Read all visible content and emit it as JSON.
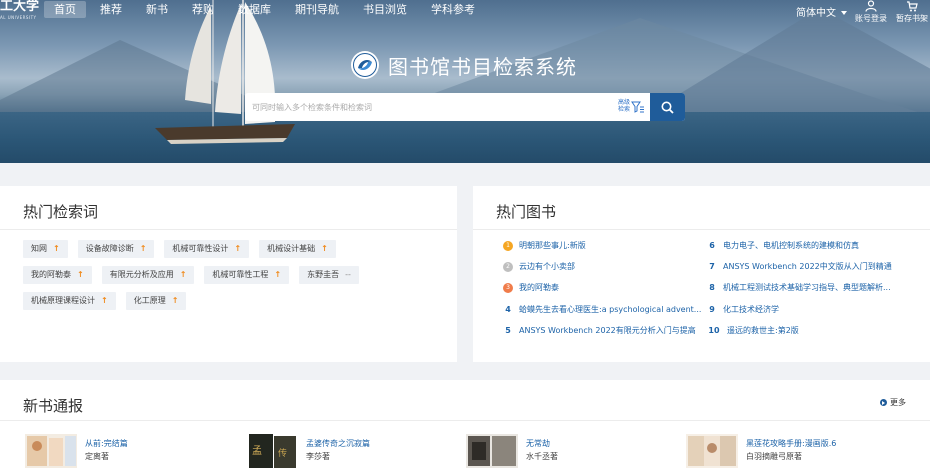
{
  "header": {
    "logo_text": "工大学",
    "logo_sub": "AL UNIVERSITY",
    "nav": [
      {
        "label": "首页",
        "active": true
      },
      {
        "label": "推荐"
      },
      {
        "label": "新书"
      },
      {
        "label": "荐购"
      },
      {
        "label": "数据库"
      },
      {
        "label": "期刊导航"
      },
      {
        "label": "书目浏览"
      },
      {
        "label": "学科参考"
      }
    ],
    "language": "简体中文",
    "account_label": "账号登录",
    "shelf_label": "暂存书架"
  },
  "hero": {
    "title": "图书馆书目检索系统",
    "search_placeholder": "可同时输入多个检索条件和检索词",
    "advanced_line1": "高级",
    "advanced_line2": "检索"
  },
  "hot_keywords": {
    "title": "热门检索词",
    "rows": [
      [
        {
          "label": "知网",
          "trend": "↑"
        },
        {
          "label": "设备故障诊断",
          "trend": "↑"
        },
        {
          "label": "机械可靠性设计",
          "trend": "↑"
        },
        {
          "label": "机械设计基础",
          "trend": "↑"
        }
      ],
      [
        {
          "label": "我的阿勒泰",
          "trend": "↑"
        },
        {
          "label": "有限元分析及应用",
          "trend": "↑"
        },
        {
          "label": "机械可靠性工程",
          "trend": "↑"
        },
        {
          "label": "东野圭吾",
          "trend": "--"
        }
      ],
      [
        {
          "label": "机械原理课程设计",
          "trend": "↑"
        },
        {
          "label": "化工原理",
          "trend": "↑"
        }
      ]
    ]
  },
  "hot_books": {
    "title": "热门图书",
    "left": [
      {
        "rank": "1",
        "title": "明朝那些事儿:新版"
      },
      {
        "rank": "2",
        "title": "云边有个小卖部"
      },
      {
        "rank": "3",
        "title": "我的阿勒泰"
      },
      {
        "rank": "4",
        "title": "蛤蟆先生去看心理医生:a psychological advent..."
      },
      {
        "rank": "5",
        "title": "ANSYS Workbench 2022有限元分析入门与提高"
      }
    ],
    "right": [
      {
        "rank": "6",
        "title": "电力电子、电机控制系统的建模和仿真"
      },
      {
        "rank": "7",
        "title": "ANSYS Workbench 2022中文版从入门到精通"
      },
      {
        "rank": "8",
        "title": "机械工程测试技术基础学习指导、典型题解析..."
      },
      {
        "rank": "9",
        "title": "化工技术经济学"
      },
      {
        "rank": "10",
        "title": "遥远的救世主:第2版"
      }
    ]
  },
  "new_books": {
    "title": "新书通报",
    "more_label": "更多",
    "items": [
      {
        "title": "从前:完结篇",
        "author": "定离著"
      },
      {
        "title": "孟婆传奇之沉寂篇",
        "author": "李莎著"
      },
      {
        "title": "无常劫",
        "author": "水千丞著"
      },
      {
        "title": "黑莲花攻略手册:漫画版.6",
        "author": "白羽摘雕弓原著"
      }
    ]
  }
}
